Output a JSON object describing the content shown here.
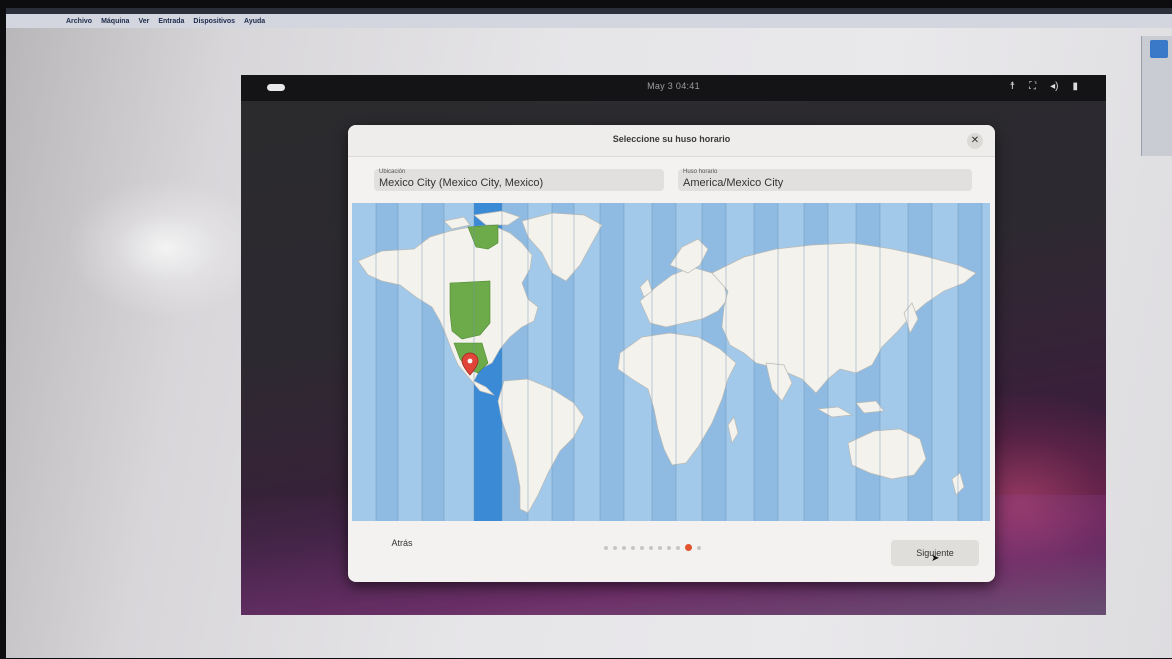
{
  "host": {
    "menu": [
      "Archivo",
      "Máquina",
      "Ver",
      "Entrada",
      "Dispositivos",
      "Ayuda"
    ]
  },
  "vm": {
    "clock": "May 3  04:41",
    "tray_icons": [
      "accessibility-icon",
      "network-icon",
      "volume-icon",
      "battery-icon"
    ]
  },
  "dialog": {
    "title": "Seleccione su huso horario",
    "location": {
      "label": "Ubicación",
      "value": "Mexico City (Mexico City, Mexico)"
    },
    "timezone": {
      "label": "Huso horario",
      "value": "America/Mexico City"
    },
    "back_label": "Atrás",
    "next_label": "Siguiente",
    "steps_total": 11,
    "step_current": 10
  },
  "colors": {
    "ocean": "#a3c9ea",
    "land": "#f4f2ec",
    "selected_band": "#3a8ad6",
    "selected_zone": "#6caa4a",
    "pin": "#e0453a",
    "progress_active": "#e2552c"
  }
}
